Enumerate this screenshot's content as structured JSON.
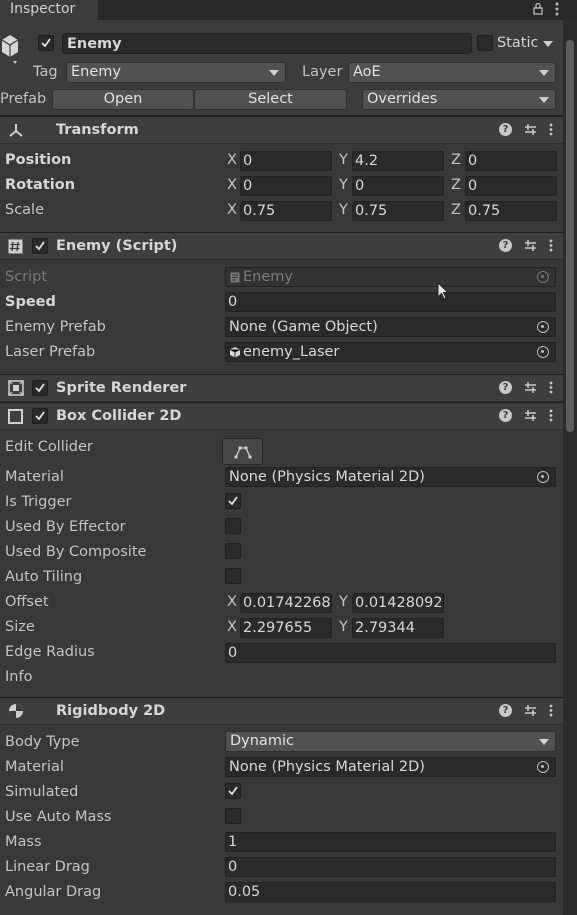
{
  "tab": {
    "label": "Inspector"
  },
  "header": {
    "object_name": "Enemy",
    "static_label": "Static",
    "tag_label": "Tag",
    "tag_value": "Enemy",
    "layer_label": "Layer",
    "layer_value": "AoE",
    "prefab_label": "Prefab",
    "open_label": "Open",
    "select_label": "Select",
    "overrides_label": "Overrides"
  },
  "transform": {
    "title": "Transform",
    "position_label": "Position",
    "rotation_label": "Rotation",
    "scale_label": "Scale",
    "position": {
      "x": "0",
      "y": "4.2",
      "z": "0"
    },
    "rotation": {
      "x": "0",
      "y": "0",
      "z": "0"
    },
    "scale": {
      "x": "0.75",
      "y": "0.75",
      "z": "0.75"
    }
  },
  "axes": {
    "x": "X",
    "y": "Y",
    "z": "Z"
  },
  "enemy_script": {
    "title": "Enemy (Script)",
    "script_label": "Script",
    "script_value": "Enemy",
    "speed_label": "Speed",
    "speed_value": "0",
    "enemy_prefab_label": "Enemy Prefab",
    "enemy_prefab_value": "None (Game Object)",
    "laser_prefab_label": "Laser Prefab",
    "laser_prefab_value": "enemy_Laser"
  },
  "sprite_renderer": {
    "title": "Sprite Renderer"
  },
  "box_collider": {
    "title": "Box Collider 2D",
    "edit_collider_label": "Edit Collider",
    "material_label": "Material",
    "material_value": "None (Physics Material 2D)",
    "is_trigger_label": "Is Trigger",
    "is_trigger": true,
    "used_by_effector_label": "Used By Effector",
    "used_by_effector": false,
    "used_by_composite_label": "Used By Composite",
    "used_by_composite": false,
    "auto_tiling_label": "Auto Tiling",
    "auto_tiling": false,
    "offset_label": "Offset",
    "offset": {
      "x": "0.01742268",
      "y": "0.01428092"
    },
    "size_label": "Size",
    "size": {
      "x": "2.297655",
      "y": "2.79344"
    },
    "edge_radius_label": "Edge Radius",
    "edge_radius_value": "0",
    "info_label": "Info"
  },
  "rigidbody": {
    "title": "Rigidbody 2D",
    "body_type_label": "Body Type",
    "body_type_value": "Dynamic",
    "material_label": "Material",
    "material_value": "None (Physics Material 2D)",
    "simulated_label": "Simulated",
    "simulated": true,
    "use_auto_mass_label": "Use Auto Mass",
    "use_auto_mass": false,
    "mass_label": "Mass",
    "mass_value": "1",
    "linear_drag_label": "Linear Drag",
    "linear_drag_value": "0",
    "angular_drag_label": "Angular Drag",
    "angular_drag_value": "0.05"
  },
  "colors": {
    "background": "#383838",
    "header_bg": "#3e3e3e",
    "field_bg": "#2a2a2a",
    "text": "#c4c4c4"
  }
}
